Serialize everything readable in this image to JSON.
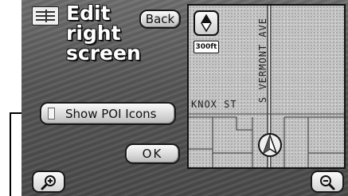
{
  "header": {
    "title_lines": [
      "Edit",
      "right",
      "screen"
    ],
    "back_label": "Back",
    "list_icon": "list-icon"
  },
  "options": {
    "show_poi_label": "Show POI Icons",
    "ok_label": "OK"
  },
  "map": {
    "scale_label": "300ft",
    "streets": {
      "north_south": "S VERMONT AVE",
      "east_west": "KNOX ST"
    },
    "compass_icon": "north-up-compass-icon",
    "vehicle_icon": "vehicle-position-icon"
  },
  "zoom": {
    "in_icon": "zoom-in-icon",
    "out_icon": "zoom-out-icon"
  },
  "colors": {
    "screen_background": "#555555",
    "button_face": "#d9d9d9",
    "title_text": "#ffffff",
    "map_background": "#c4c4c4"
  }
}
